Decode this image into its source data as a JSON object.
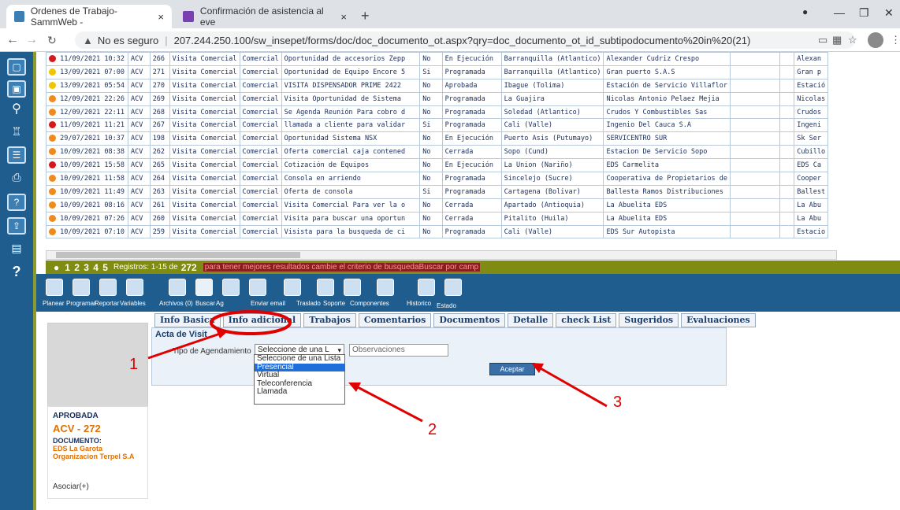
{
  "browser": {
    "tabs": [
      {
        "title": "Ordenes de Trabajo-SammWeb -",
        "close": "×"
      },
      {
        "title": "Confirmación de asistencia al eve",
        "close": "×"
      }
    ],
    "new_tab": "+",
    "url_warning": "No es seguro",
    "url": "207.244.250.100/sw_insepet/forms/doc/doc_documento_ot.aspx?qry=doc_documento_ot_id_subtipodocumento%20in%20(21)"
  },
  "grid": {
    "rows": [
      {
        "status_color": "#d21a1a",
        "date": "11/09/2021 10:32",
        "code": "ACV",
        "num": "266",
        "type": "Visita Comercial",
        "area": "Comercial",
        "desc": "Oportunidad de accesorios Zepp",
        "flag": "No",
        "state": "En Ejecución",
        "city": "Barranquilla (Atlantico)",
        "client": "Alexander Cudriz Crespo",
        "short": "Alexan"
      },
      {
        "status_color": "#f2c400",
        "date": "13/09/2021 07:00",
        "code": "ACV",
        "num": "271",
        "type": "Visita Comercial",
        "area": "Comercial",
        "desc": "Oportunidad de Equipo Encore 5",
        "flag": "Si",
        "state": "Programada",
        "city": "Barranquilla (Atlantico)",
        "client": "Gran puerto S.A.S",
        "short": "Gran p"
      },
      {
        "status_color": "#f2c400",
        "date": "13/09/2021 05:54",
        "code": "ACV",
        "num": "270",
        "type": "Visita Comercial",
        "area": "Comercial",
        "desc": "VISITA DISPENSADOR PRIME 2422",
        "flag": "No",
        "state": "Aprobada",
        "city": "Ibague (Tolima)",
        "client": "Estación de Servicio Villaflor",
        "short": "Estació"
      },
      {
        "status_color": "#f08a1c",
        "date": "12/09/2021 22:26",
        "code": "ACV",
        "num": "269",
        "type": "Visita Comercial",
        "area": "Comercial",
        "desc": "Visita Oportunidad de Sistema",
        "flag": "No",
        "state": "Programada",
        "city": "La Guajira",
        "client": "Nicolas Antonio Pelaez Mejia",
        "short": "Nicolas"
      },
      {
        "status_color": "#f08a1c",
        "date": "12/09/2021 22:11",
        "code": "ACV",
        "num": "268",
        "type": "Visita Comercial",
        "area": "Comercial",
        "desc": "Se Agenda Reunión Para cobro d",
        "flag": "No",
        "state": "Programada",
        "city": "Soledad (Atlantico)",
        "client": "Crudos Y Combustibles Sas",
        "short": "Crudos"
      },
      {
        "status_color": "#d21a1a",
        "date": "11/09/2021 11:21",
        "code": "ACV",
        "num": "267",
        "type": "Visita Comercial",
        "area": "Comercial",
        "desc": "llamada a cliente para validar",
        "flag": "Si",
        "state": "Programada",
        "city": "Cali (Valle)",
        "client": "Ingenio Del Cauca S.A",
        "short": "Ingeni"
      },
      {
        "status_color": "#f08a1c",
        "date": "29/07/2021 10:37",
        "code": "ACV",
        "num": "198",
        "type": "Visita Comercial",
        "area": "Comercial",
        "desc": "Oportunidad Sistema NSX",
        "flag": "No",
        "state": "En Ejecución",
        "city": "Puerto Asis (Putumayo)",
        "client": "SERVICENTRO SUR",
        "short": "Sk Ser"
      },
      {
        "status_color": "#f08a1c",
        "date": "10/09/2021 08:38",
        "code": "ACV",
        "num": "262",
        "type": "Visita Comercial",
        "area": "Comercial",
        "desc": "Oferta comercial caja contened",
        "flag": "No",
        "state": "Cerrada",
        "city": "Sopo (Cund)",
        "client": "Estacion De Servicio Sopo",
        "short": "Cubillo"
      },
      {
        "status_color": "#d21a1a",
        "date": "10/09/2021 15:58",
        "code": "ACV",
        "num": "265",
        "type": "Visita Comercial",
        "area": "Comercial",
        "desc": "Cotización de Equipos",
        "flag": "No",
        "state": "En Ejecución",
        "city": "La Union (Nariño)",
        "client": "EDS Carmelita",
        "short": "EDS Ca"
      },
      {
        "status_color": "#f08a1c",
        "date": "10/09/2021 11:58",
        "code": "ACV",
        "num": "264",
        "type": "Visita Comercial",
        "area": "Comercial",
        "desc": "Consola en arriendo",
        "flag": "No",
        "state": "Programada",
        "city": "Sincelejo (Sucre)",
        "client": "Cooperativa de Propietarios de",
        "short": "Cooper"
      },
      {
        "status_color": "#f08a1c",
        "date": "10/09/2021 11:49",
        "code": "ACV",
        "num": "263",
        "type": "Visita Comercial",
        "area": "Comercial",
        "desc": "Oferta de consola",
        "flag": "Si",
        "state": "Programada",
        "city": "Cartagena (Bolivar)",
        "client": "Ballesta Ramos Distribuciones",
        "short": "Ballest"
      },
      {
        "status_color": "#f08a1c",
        "date": "10/09/2021 08:16",
        "code": "ACV",
        "num": "261",
        "type": "Visita Comercial",
        "area": "Comercial",
        "desc": "Visita Comercial Para ver la o",
        "flag": "No",
        "state": "Cerrada",
        "city": "Apartado (Antioquia)",
        "client": "La Abuelita EDS",
        "short": "La Abu"
      },
      {
        "status_color": "#f08a1c",
        "date": "10/09/2021 07:26",
        "code": "ACV",
        "num": "260",
        "type": "Visita Comercial",
        "area": "Comercial",
        "desc": "Visita para buscar una oportun",
        "flag": "No",
        "state": "Cerrada",
        "city": "Pitalito (Huila)",
        "client": "La Abuelita EDS",
        "short": "La Abu"
      },
      {
        "status_color": "#f08a1c",
        "date": "10/09/2021 07:10",
        "code": "ACV",
        "num": "259",
        "type": "Visita Comercial",
        "area": "Comercial",
        "desc": "Visista para la busqueda de ci",
        "flag": "No",
        "state": "Programada",
        "city": "Cali (Valle)",
        "client": "EDS Sur Autopista",
        "short": "Estacio"
      }
    ]
  },
  "pager": {
    "pages": "1 2 3 4 5",
    "records_label": "Registros: 1-15 de",
    "total": "272",
    "hint": "para tener mejores resultados cambie el criterio de busquedaBuscar por camp"
  },
  "toolbar": {
    "labels": [
      "Planear",
      "Programar",
      "Reportar",
      "Variables",
      "Archivos (0)",
      "Buscar",
      "Ag",
      "",
      "Enviar email",
      "Traslado",
      "Soporte",
      "Componentes",
      "Historico",
      "Estado"
    ]
  },
  "tabs": [
    "Info Basica",
    "Info adicional",
    "Trabajos",
    "Comentarios",
    "Documentos",
    "Detalle",
    "check List",
    "Sugeridos",
    "Evaluaciones"
  ],
  "form": {
    "section_title": "Acta de Visit",
    "tipo_label": "Tipo de Agendamiento",
    "tipo_value": "Seleccione de una L",
    "obs_placeholder": "Observaciones",
    "accept_label": "Aceptar",
    "options": [
      "Seleccione de una Lista",
      "Presencial",
      "Virtual",
      "Teleconferencia",
      "Llamada"
    ],
    "selected_option": "Presencial"
  },
  "summary": {
    "status": "APROBADA",
    "id": "ACV - 272",
    "doc_label": "DOCUMENTO:",
    "name": "EDS La Garota Organizacion Terpel S.A",
    "associate": "Asociar(+)"
  },
  "annotations": {
    "n1": "1",
    "n2": "2",
    "n3": "3",
    "color": "#e00000"
  }
}
